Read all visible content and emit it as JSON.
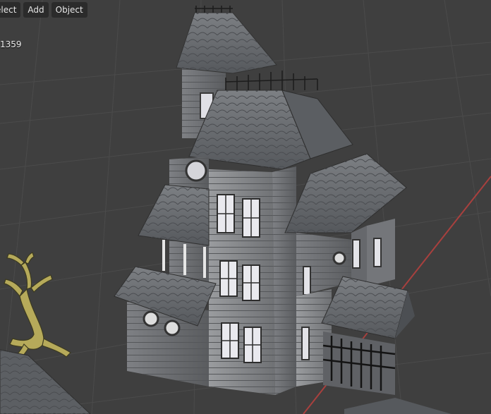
{
  "header": {
    "menu": [
      {
        "label": "elect",
        "name": "select-menu"
      },
      {
        "label": "Add",
        "name": "add-menu"
      },
      {
        "label": "Object",
        "name": "object-menu"
      }
    ]
  },
  "overlay": {
    "stat_text": "1359"
  },
  "colors": {
    "viewport_bg": "#3f3f3f",
    "grid_line": "#4a4a4a",
    "x_axis": "#a8403e",
    "roof": "#6b6e72",
    "wall": "#8d8f92",
    "window_glow": "#e9e9ee",
    "tree": "#b6aa5a"
  },
  "scene": {
    "objects": [
      "haunted-house-model",
      "dead-tree-model",
      "ground-tile-roof"
    ]
  }
}
